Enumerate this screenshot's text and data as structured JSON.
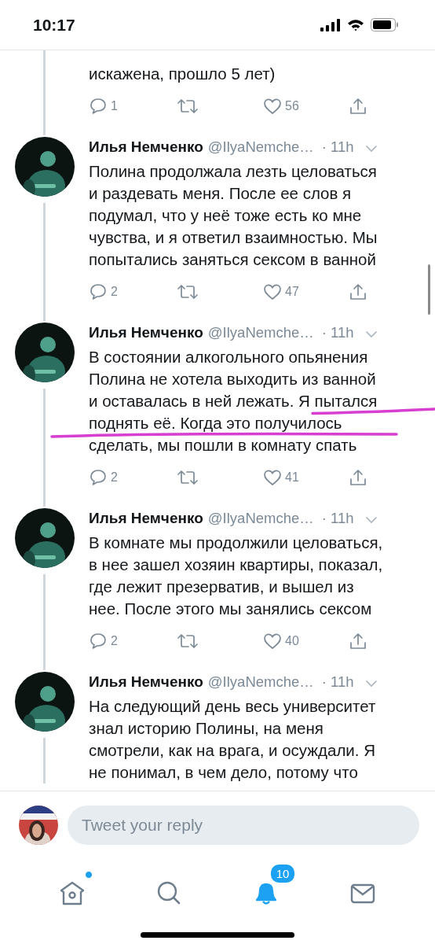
{
  "status_bar": {
    "time": "10:17"
  },
  "tweets": [
    {
      "kind": "partial",
      "text": "искажена, прошло 5 лет)",
      "replies": "1",
      "likes": "56",
      "hand_underline": false
    },
    {
      "kind": "full",
      "name": "Илья Немченко",
      "handle": "@IlyaNemche…",
      "time": "· 11h",
      "text": "Полина продолжала лезть целоваться\nи раздевать меня. После ее слов я\nподумал, что у неё тоже есть ко мне\nчувства, и я ответил взаимностью. Мы\nпопытались заняться сексом в ванной",
      "replies": "2",
      "likes": "47",
      "hand_underline": false
    },
    {
      "kind": "full",
      "name": "Илья Немченко",
      "handle": "@IlyaNemche…",
      "time": "· 11h",
      "text": "В состоянии алкогольного опьянения\nПолина не хотела выходить из ванной\nи оставалась в ней лежать. Я пытался\nподнять её. Когда это получилось\nсделать, мы пошли в комнату спать",
      "replies": "2",
      "likes": "41",
      "hand_underline": true
    },
    {
      "kind": "full",
      "name": "Илья Немченко",
      "handle": "@IlyaNemche…",
      "time": "· 11h",
      "text": "В комнате мы продолжили целоваться,\nв нее зашел хозяин квартиры, показал,\nгде лежит презерватив, и вышел из\nнее. После этого мы занялись сексом",
      "replies": "2",
      "likes": "40",
      "hand_underline": false
    },
    {
      "kind": "cut",
      "name": "Илья Немченко",
      "handle": "@IlyaNemche…",
      "time": "· 11h",
      "text": "На следующий день весь университет\nзнал историю Полины, на меня\nсмотрели, как на врага, и осуждали. Я\nне понимал, в чем дело, потому что",
      "hand_underline": false
    }
  ],
  "reply": {
    "placeholder": "Tweet your reply"
  },
  "tabs": [
    {
      "kind": "home",
      "selected": false,
      "dot": true
    },
    {
      "kind": "search",
      "selected": false,
      "dot": false
    },
    {
      "kind": "notifications",
      "selected": true,
      "dot": false,
      "badge": "10"
    },
    {
      "kind": "messages",
      "selected": false,
      "dot": false
    }
  ]
}
